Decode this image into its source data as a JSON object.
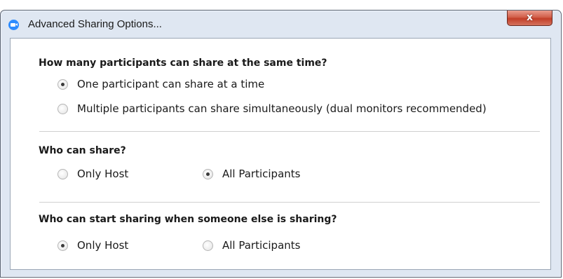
{
  "window": {
    "title": "Advanced Sharing Options...",
    "close_label": "x"
  },
  "sections": [
    {
      "question": "How many participants can share at the same time?",
      "options": [
        {
          "label": "One participant can share at a time",
          "selected": true
        },
        {
          "label": "Multiple participants can share simultaneously (dual monitors recommended)",
          "selected": false
        }
      ]
    },
    {
      "question": "Who can share?",
      "options": [
        {
          "label": "Only Host",
          "selected": false
        },
        {
          "label": "All Participants",
          "selected": true
        }
      ]
    },
    {
      "question": "Who can start sharing when someone else is sharing?",
      "options": [
        {
          "label": "Only Host",
          "selected": true
        },
        {
          "label": "All Participants",
          "selected": false
        }
      ]
    }
  ],
  "colors": {
    "app_icon": "#2d8cff",
    "close_button": "#c8452f",
    "window_frame": "#dfe7f2"
  }
}
